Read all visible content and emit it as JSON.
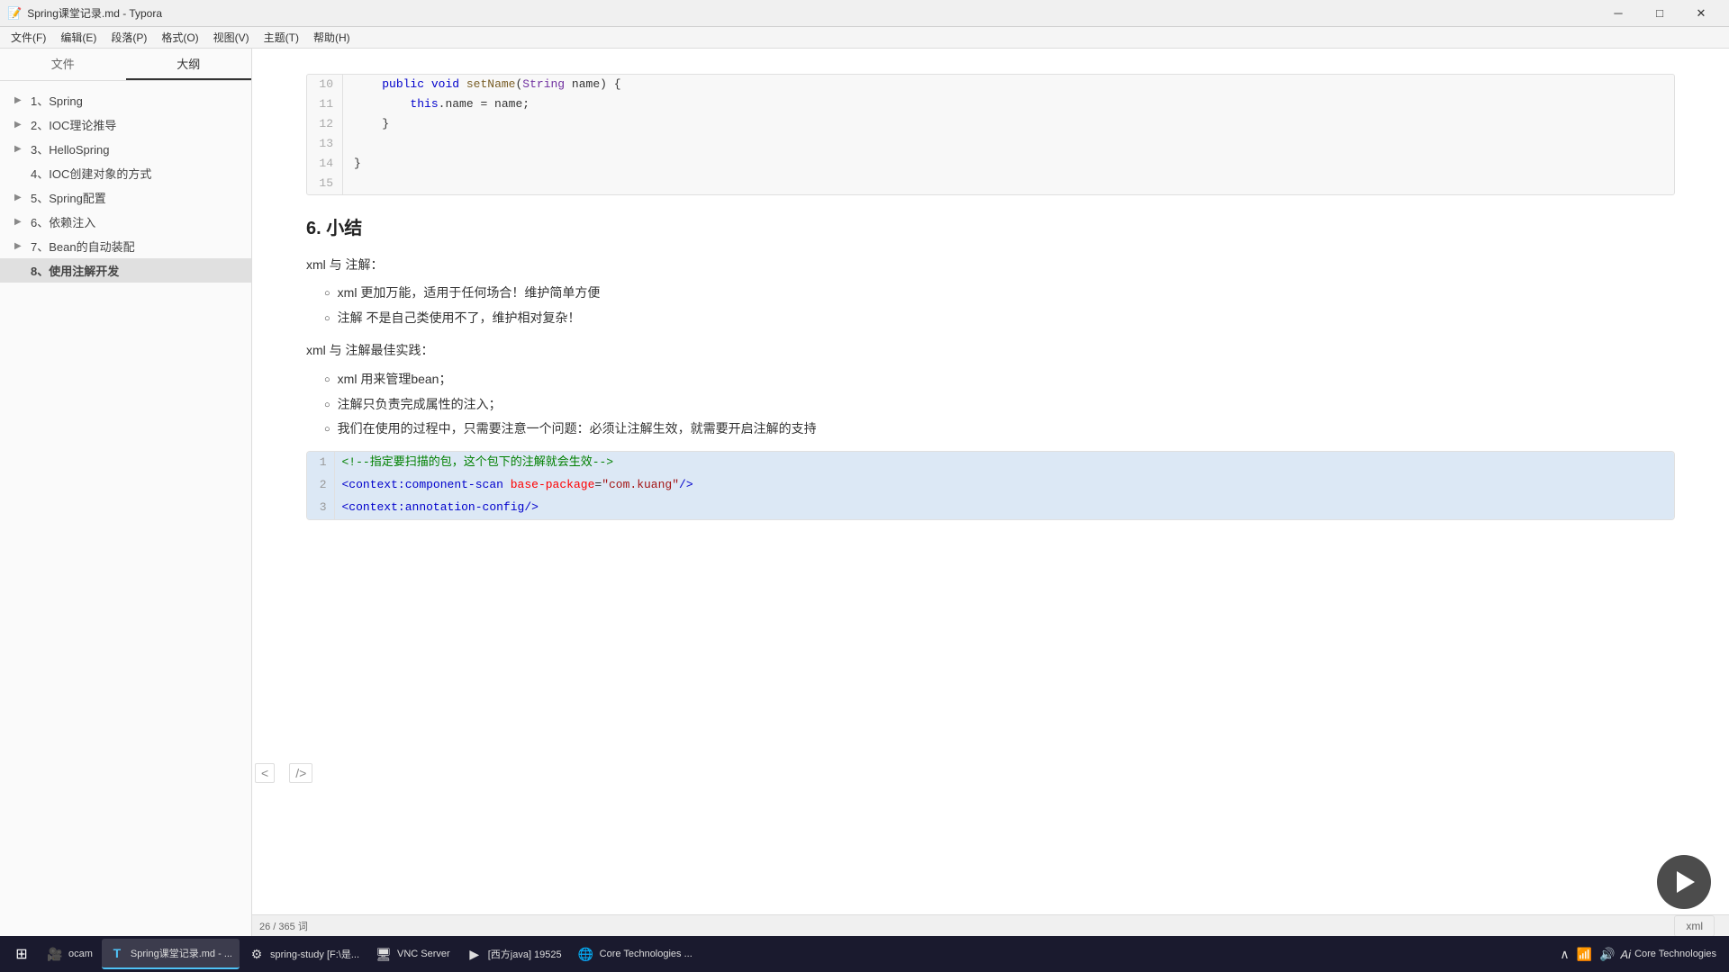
{
  "window": {
    "title": "Spring课堂记录.md - Typora"
  },
  "menu": {
    "items": [
      "文件(F)",
      "编辑(E)",
      "段落(P)",
      "格式(O)",
      "视图(V)",
      "主题(T)",
      "帮助(H)"
    ]
  },
  "sidebar": {
    "tab_file": "文件",
    "tab_outline": "大纲",
    "outline_items": [
      {
        "id": 1,
        "label": "1、Spring",
        "has_arrow": true,
        "active": false
      },
      {
        "id": 2,
        "label": "2、IOC理论推导",
        "has_arrow": true,
        "active": false
      },
      {
        "id": 3,
        "label": "3、HelloSpring",
        "has_arrow": true,
        "active": false
      },
      {
        "id": 4,
        "label": "4、IOC创建对象的方式",
        "has_arrow": false,
        "active": false
      },
      {
        "id": 5,
        "label": "5、Spring配置",
        "has_arrow": true,
        "active": false
      },
      {
        "id": 6,
        "label": "6、依赖注入",
        "has_arrow": true,
        "active": false
      },
      {
        "id": 7,
        "label": "7、Bean的自动装配",
        "has_arrow": true,
        "active": false
      },
      {
        "id": 8,
        "label": "8、使用注解开发",
        "has_arrow": false,
        "active": true
      }
    ]
  },
  "code_block_top": {
    "lines": [
      {
        "num": "10",
        "code": "    public void setName(String name) {"
      },
      {
        "num": "11",
        "code": "        this.name = name;"
      },
      {
        "num": "12",
        "code": "    }"
      },
      {
        "num": "13",
        "code": ""
      },
      {
        "num": "14",
        "code": "}"
      },
      {
        "num": "15",
        "code": ""
      }
    ]
  },
  "section": {
    "heading": "6. 小结",
    "sub1": "xml 与 注解：",
    "bullets1": [
      "xml 更加万能，适用于任何场合！维护简单方便",
      "注解 不是自己类使用不了，维护相对复杂！"
    ],
    "sub2": "xml 与 注解最佳实践：",
    "bullets2": [
      "xml 用来管理bean；",
      "注解只负责完成属性的注入；",
      "我们在使用的过程中，只需要注意一个问题：必须让注解生效，就需要开启注解的支持"
    ]
  },
  "xml_code": {
    "lines": [
      {
        "num": "1",
        "code": "<!--指定要扫描的包，这个包下的注解就会生效-->",
        "highlight": false
      },
      {
        "num": "2",
        "code": "<context:component-scan base-package=\"com.kuang\"/>",
        "highlight": false
      },
      {
        "num": "3",
        "code": "<context:annotation-config/>",
        "highlight": false
      }
    ]
  },
  "status_bar": {
    "position": "26 / 365 词",
    "zoom": "",
    "lang": "xml"
  },
  "collapse_buttons": {
    "left": "<",
    "right": "/>"
  },
  "taskbar": {
    "apps": [
      {
        "label": "ocam",
        "icon": "🎥",
        "active": false
      },
      {
        "label": "Spring课堂记录.md - ...",
        "icon": "T",
        "active": true
      },
      {
        "label": "spring-study [F:\\是...",
        "icon": "⚙",
        "active": false
      },
      {
        "label": "VNC Server",
        "icon": "🖥",
        "active": false
      },
      {
        "label": "[西方java] 19525",
        "icon": "▶",
        "active": false
      },
      {
        "label": "Core Technologies ...",
        "icon": "🌐",
        "active": false
      }
    ],
    "tray": {
      "time": "Core Technologies",
      "ai_label": "Ai"
    }
  },
  "video_overlay": {
    "visible": true
  }
}
